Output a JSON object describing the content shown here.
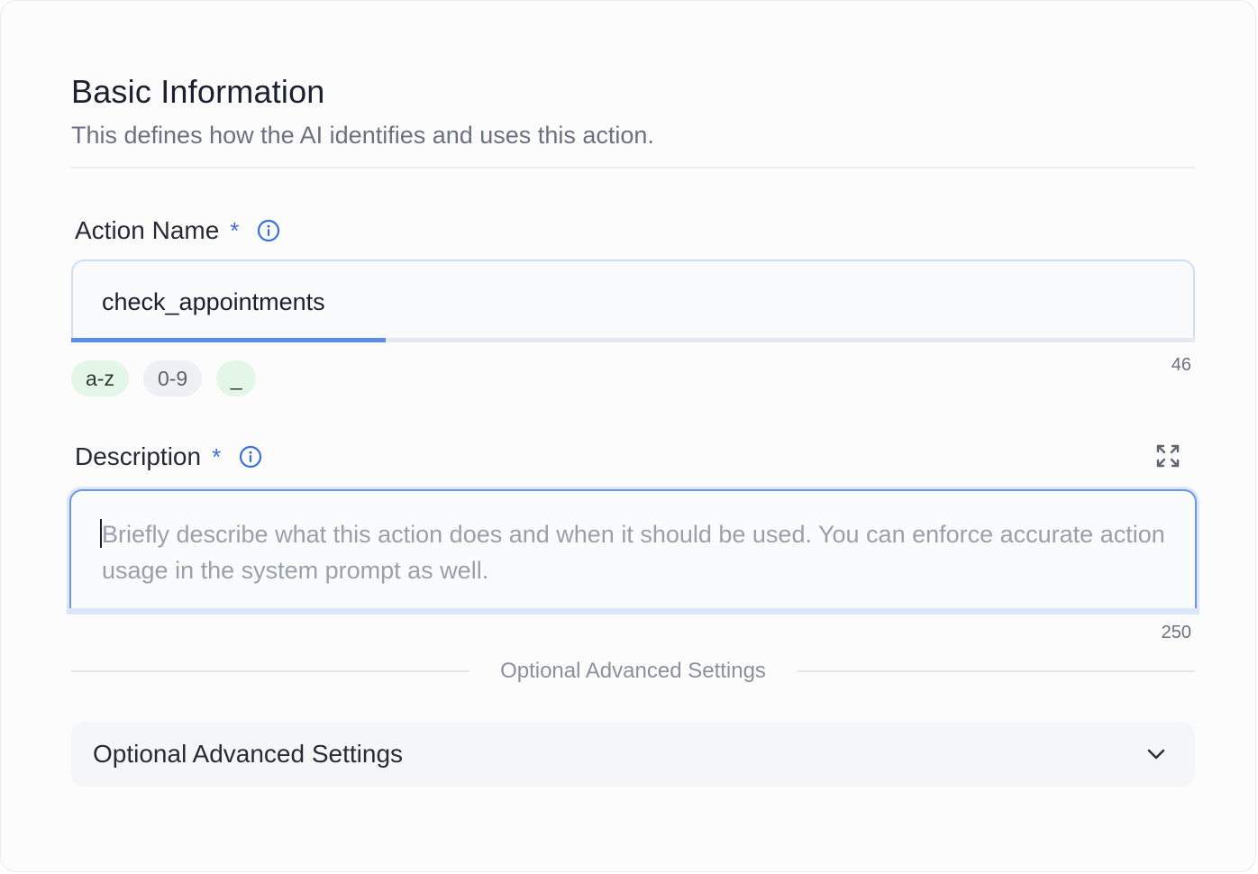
{
  "section": {
    "title": "Basic Information",
    "subtitle": "This defines how the AI identifies and uses this action."
  },
  "action_name": {
    "label": "Action Name",
    "required_marker": "*",
    "info_icon": "info-circle-icon",
    "value": "check_appointments",
    "char_count": "46",
    "fill_fraction": 0.28,
    "chips": [
      {
        "label": "a-z",
        "active": true
      },
      {
        "label": "0-9",
        "active": false
      },
      {
        "label": "_",
        "active": true
      }
    ]
  },
  "description": {
    "label": "Description",
    "required_marker": "*",
    "info_icon": "info-circle-icon",
    "expand_icon": "expand-icon",
    "placeholder": "Briefly describe what this action does and when it should be used. You can enforce accurate action usage in the system prompt as well.",
    "char_count": "250"
  },
  "advanced": {
    "divider_text": "Optional Advanced Settings",
    "accordion_title": "Optional Advanced Settings",
    "accordion_icon": "chevron-down-icon"
  },
  "colors": {
    "accent": "#3b6fd6",
    "chip_active_bg": "#e3f6e7",
    "chip_inactive_bg": "#eef0f3"
  }
}
